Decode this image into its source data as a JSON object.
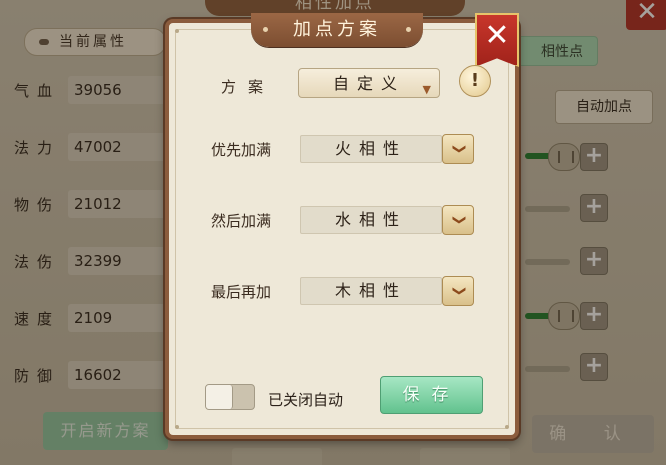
{
  "background": {
    "title": "相性加点",
    "close_glyph": "✕",
    "tab_label": "当前属性",
    "right_tab_label": "相性点",
    "auto_button": "自动加点",
    "stats": [
      {
        "name": "气血",
        "value": "39056"
      },
      {
        "name": "法力",
        "value": "47002"
      },
      {
        "name": "物伤",
        "value": "21012"
      },
      {
        "name": "法伤",
        "value": "32399"
      },
      {
        "name": "速度",
        "value": "2109"
      },
      {
        "name": "防御",
        "value": "16602"
      }
    ],
    "new_plan_button": "开启新方案",
    "confirm_button": "确 认",
    "plus_glyph": "+"
  },
  "modal": {
    "title": "加点方案",
    "close_glyph": "✕",
    "scheme_label": "方案",
    "scheme_value": "自定义",
    "dropdown_glyph": "▼",
    "info_glyph": "!",
    "priority_rows": [
      {
        "label": "优先加满",
        "value": "火相性"
      },
      {
        "label": "然后加满",
        "value": "水相性"
      },
      {
        "label": "最后再加",
        "value": "木相性"
      }
    ],
    "expand_glyph": "❯",
    "toggle_label": "已关闭自动",
    "toggle_on": false,
    "save_button": "保存"
  },
  "colors": {
    "frame_brown": "#8b5c3d",
    "save_green": "#62c28e",
    "close_red": "#c8362b"
  }
}
